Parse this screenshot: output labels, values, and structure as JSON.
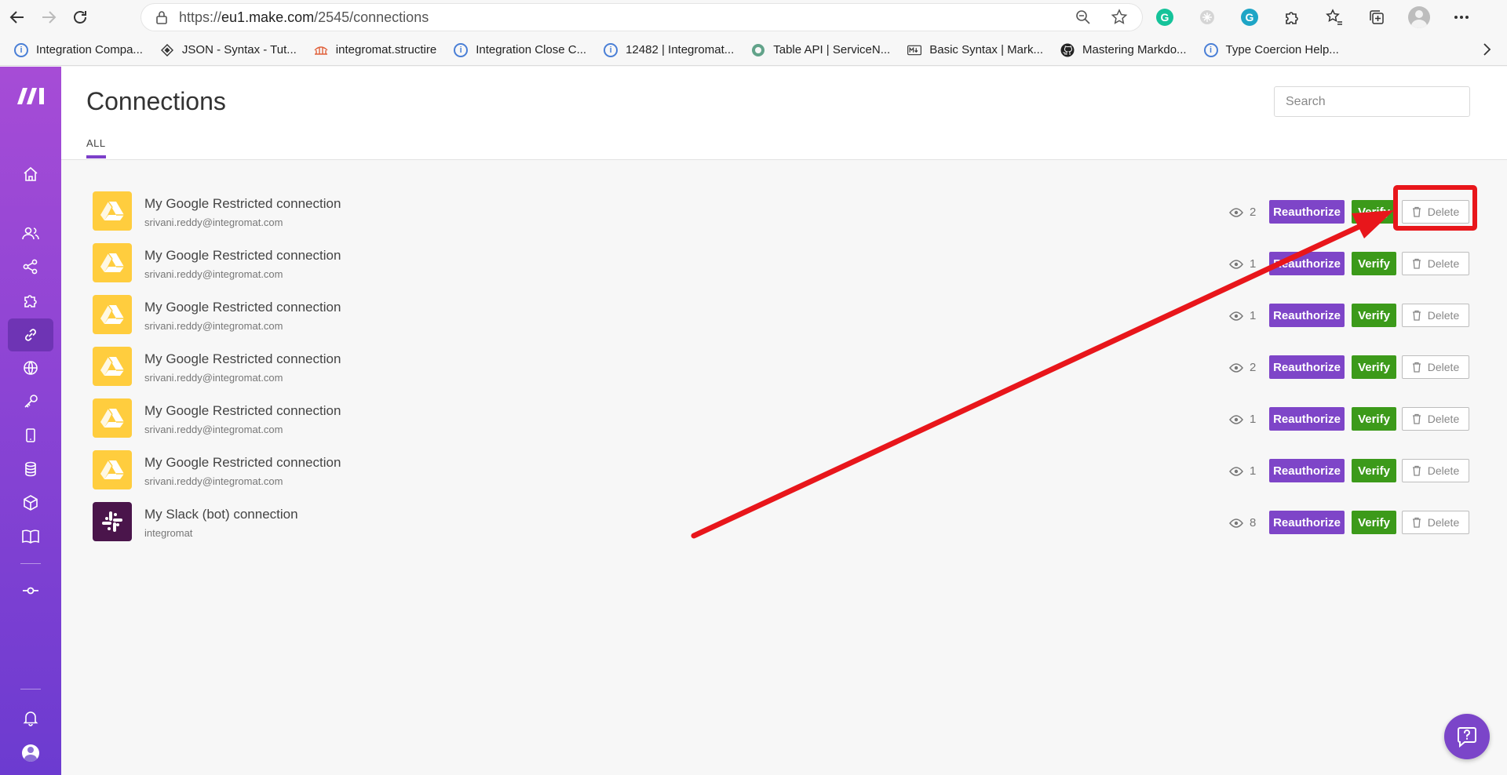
{
  "browser": {
    "url_prefix": "https://",
    "url_host": "eu1.make.com",
    "url_path": "/2545/connections",
    "bookmarks": [
      {
        "label": "Integration Compa...",
        "icon": "info-icon"
      },
      {
        "label": "JSON - Syntax - Tut...",
        "icon": "diamond-icon"
      },
      {
        "label": "integromat.structire",
        "icon": "bridge-icon"
      },
      {
        "label": "Integration Close C...",
        "icon": "info-icon"
      },
      {
        "label": "12482 | Integromat...",
        "icon": "info-icon"
      },
      {
        "label": "Table API | ServiceN...",
        "icon": "servicenow-icon"
      },
      {
        "label": "Basic Syntax | Mark...",
        "icon": "markdown-icon"
      },
      {
        "label": "Mastering Markdo...",
        "icon": "github-icon"
      },
      {
        "label": "Type Coercion Help...",
        "icon": "info-icon"
      }
    ]
  },
  "page": {
    "title": "Connections",
    "tab_all": "ALL",
    "search_placeholder": "Search"
  },
  "buttons": {
    "reauthorize": "Reauthorize",
    "verify": "Verify",
    "delete": "Delete"
  },
  "connections": [
    {
      "name": "My Google Restricted connection",
      "account": "srivani.reddy@integromat.com",
      "views": "2",
      "app": "google-drive"
    },
    {
      "name": "My Google Restricted connection",
      "account": "srivani.reddy@integromat.com",
      "views": "1",
      "app": "google-drive"
    },
    {
      "name": "My Google Restricted connection",
      "account": "srivani.reddy@integromat.com",
      "views": "1",
      "app": "google-drive"
    },
    {
      "name": "My Google Restricted connection",
      "account": "srivani.reddy@integromat.com",
      "views": "2",
      "app": "google-drive"
    },
    {
      "name": "My Google Restricted connection",
      "account": "srivani.reddy@integromat.com",
      "views": "1",
      "app": "google-drive"
    },
    {
      "name": "My Google Restricted connection",
      "account": "srivani.reddy@integromat.com",
      "views": "1",
      "app": "google-drive"
    },
    {
      "name": "My Slack (bot) connection",
      "account": "integromat",
      "views": "8",
      "app": "slack"
    }
  ],
  "colors": {
    "sidebar_top": "#a64cd6",
    "sidebar_bottom": "#6c3bd0",
    "reauthorize": "#7e45c8",
    "verify": "#3c9a1a",
    "annotation": "#e8161b",
    "gdrive_tile": "#ffcd3e",
    "slack_tile": "#4a154b"
  }
}
